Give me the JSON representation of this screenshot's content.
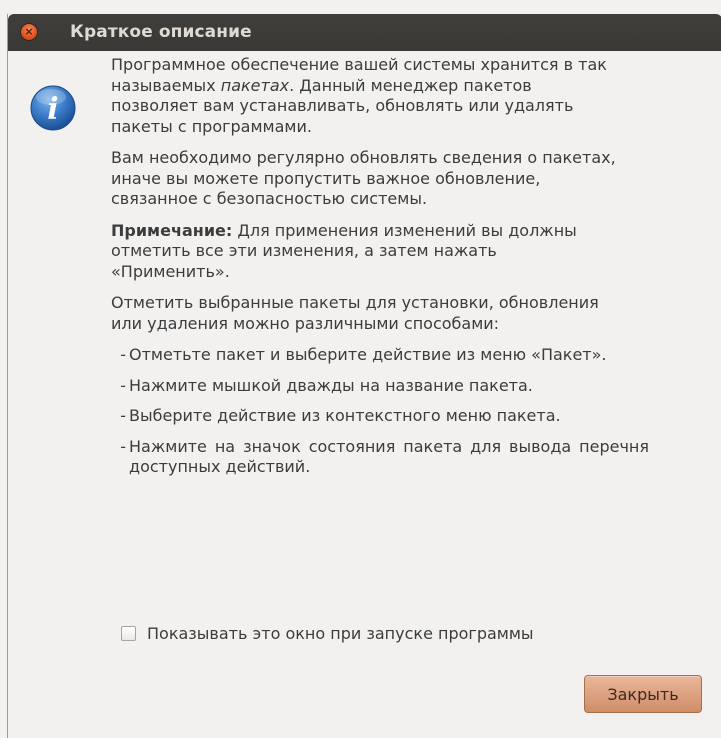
{
  "window": {
    "title": "Краткое описание"
  },
  "body": {
    "p1_a": "Программное обеспечение вашей системы хранится в так называемых ",
    "p1_em": "пакетах",
    "p1_b": ". Данный менеджер пакетов позволяет вам устанавливать, обновлять или удалять пакеты с программами.",
    "p2": "Вам необходимо регулярно обновлять сведения о пакетах, иначе вы можете пропустить важное обновление, связанное с безопасностью системы.",
    "p3_bold": "Примечание:",
    "p3_rest": " Для применения изменений вы должны отметить все эти изменения, а затем нажать «Применить».",
    "p4": "Отметить выбранные пакеты для установки, обновления или удаления можно различными способами:",
    "bullets": [
      "Отметьте пакет и выберите действие из меню «Пакет».",
      "Нажмите мышкой дважды на название пакета.",
      "Выберите действие из контекстного меню пакета.",
      "Нажмите на значок состояния пакета для вывода перечня доступных действий."
    ],
    "dash": "-"
  },
  "checkbox": {
    "label": "Показывать это окно при запуске программы",
    "checked": false
  },
  "buttons": {
    "close_label": "Закрыть"
  },
  "icons": {
    "info": "info-icon",
    "window_close": "window-close-icon"
  },
  "colors": {
    "titlebar": "#3c3b37",
    "close_accent": "#dd4814",
    "button": "#d99a76"
  }
}
